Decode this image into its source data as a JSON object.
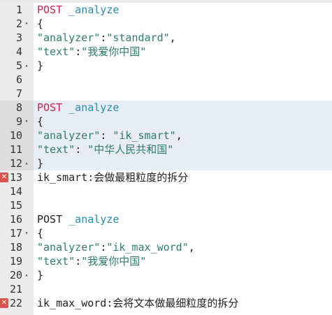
{
  "colors": {
    "method": "#c7254e",
    "endpoint": "#2a8cb3",
    "string": "#2e7d6b",
    "text": "#222222",
    "error_marker": "#d9534f",
    "gutter": "#ebebeb",
    "active_line": "#e8ecf3"
  },
  "editor": {
    "lines": [
      {
        "num": "1",
        "fold": "",
        "error": false,
        "parts": [
          {
            "t": "POST",
            "c": "kw"
          },
          {
            "t": " _analyze",
            "c": "url"
          }
        ]
      },
      {
        "num": "2",
        "fold": "▾",
        "error": false,
        "parts": [
          {
            "t": "{",
            "c": "plain"
          }
        ]
      },
      {
        "num": "3",
        "fold": "",
        "error": false,
        "parts": [
          {
            "t": "\"analyzer\"",
            "c": "str"
          },
          {
            "t": ":",
            "c": "plain"
          },
          {
            "t": "\"standard\"",
            "c": "str"
          },
          {
            "t": ",",
            "c": "plain"
          }
        ]
      },
      {
        "num": "4",
        "fold": "",
        "error": false,
        "parts": [
          {
            "t": "\"text\"",
            "c": "str"
          },
          {
            "t": ":",
            "c": "plain"
          },
          {
            "t": "\"我爱你中国\"",
            "c": "str"
          }
        ]
      },
      {
        "num": "5",
        "fold": "▴",
        "error": false,
        "parts": [
          {
            "t": "}",
            "c": "plain"
          }
        ]
      },
      {
        "num": "6",
        "fold": "",
        "error": false,
        "parts": []
      },
      {
        "num": "7",
        "fold": "",
        "error": false,
        "parts": []
      },
      {
        "num": "8",
        "fold": "",
        "error": false,
        "active": true,
        "parts": [
          {
            "t": "POST",
            "c": "kw"
          },
          {
            "t": " _analyze",
            "c": "url"
          }
        ]
      },
      {
        "num": "9",
        "fold": "▾",
        "error": false,
        "active": true,
        "parts": [
          {
            "t": "{",
            "c": "plain"
          }
        ]
      },
      {
        "num": "10",
        "fold": "",
        "error": false,
        "active": true,
        "parts": [
          {
            "t": "\"analyzer\"",
            "c": "str"
          },
          {
            "t": ": ",
            "c": "plain"
          },
          {
            "t": "\"ik_smart\"",
            "c": "str"
          },
          {
            "t": ",",
            "c": "plain"
          }
        ]
      },
      {
        "num": "11",
        "fold": "",
        "error": false,
        "active": true,
        "parts": [
          {
            "t": "\"text\"",
            "c": "str"
          },
          {
            "t": ": ",
            "c": "plain"
          },
          {
            "t": "\"中华人民共和国\"",
            "c": "str"
          }
        ]
      },
      {
        "num": "12",
        "fold": "▴",
        "error": false,
        "active": true,
        "parts": [
          {
            "t": "}",
            "c": "plain"
          }
        ]
      },
      {
        "num": "13",
        "fold": "",
        "error": true,
        "parts": [
          {
            "t": "ik_smart:会做最粗粒度的拆分",
            "c": "plain"
          }
        ]
      },
      {
        "num": "14",
        "fold": "",
        "error": false,
        "parts": []
      },
      {
        "num": "15",
        "fold": "",
        "error": false,
        "parts": []
      },
      {
        "num": "16",
        "fold": "",
        "error": false,
        "parts": [
          {
            "t": "POST",
            "c": "plain"
          },
          {
            "t": " _analyze",
            "c": "url"
          }
        ]
      },
      {
        "num": "17",
        "fold": "▾",
        "error": false,
        "parts": [
          {
            "t": "{",
            "c": "plain"
          }
        ]
      },
      {
        "num": "18",
        "fold": "",
        "error": false,
        "parts": [
          {
            "t": "\"analyzer\"",
            "c": "str"
          },
          {
            "t": ":",
            "c": "plain"
          },
          {
            "t": "\"ik_max_word\"",
            "c": "str"
          },
          {
            "t": ",",
            "c": "plain"
          }
        ]
      },
      {
        "num": "19",
        "fold": "",
        "error": false,
        "parts": [
          {
            "t": "\"text\"",
            "c": "str"
          },
          {
            "t": ":",
            "c": "plain"
          },
          {
            "t": "\"我爱你中国\"",
            "c": "str"
          }
        ]
      },
      {
        "num": "20",
        "fold": "▴",
        "error": false,
        "parts": [
          {
            "t": "}",
            "c": "plain"
          }
        ]
      },
      {
        "num": "21",
        "fold": "",
        "error": false,
        "parts": []
      },
      {
        "num": "22",
        "fold": "",
        "error": true,
        "parts": [
          {
            "t": "ik_max_word:会将文本做最细粒度的拆分",
            "c": "plain"
          }
        ]
      }
    ]
  }
}
